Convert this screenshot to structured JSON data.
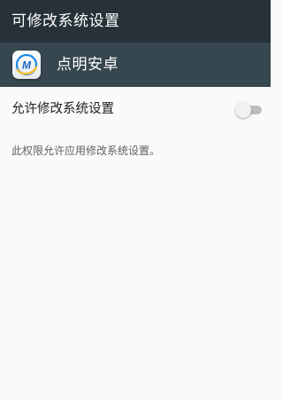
{
  "titlebar": {
    "title": "可修改系统设置"
  },
  "app": {
    "name": "点明安卓",
    "icon": "app-logo-icon"
  },
  "setting": {
    "label": "允许修改系统设置",
    "enabled": false
  },
  "description": "此权限允许应用修改系统设置。",
  "colors": {
    "titlebar_bg": "#263238",
    "appheader_bg": "#37474f",
    "page_bg": "#fafafa",
    "toggle_track_off": "#bdbdbd",
    "toggle_thumb_off": "#f1f1f1"
  }
}
